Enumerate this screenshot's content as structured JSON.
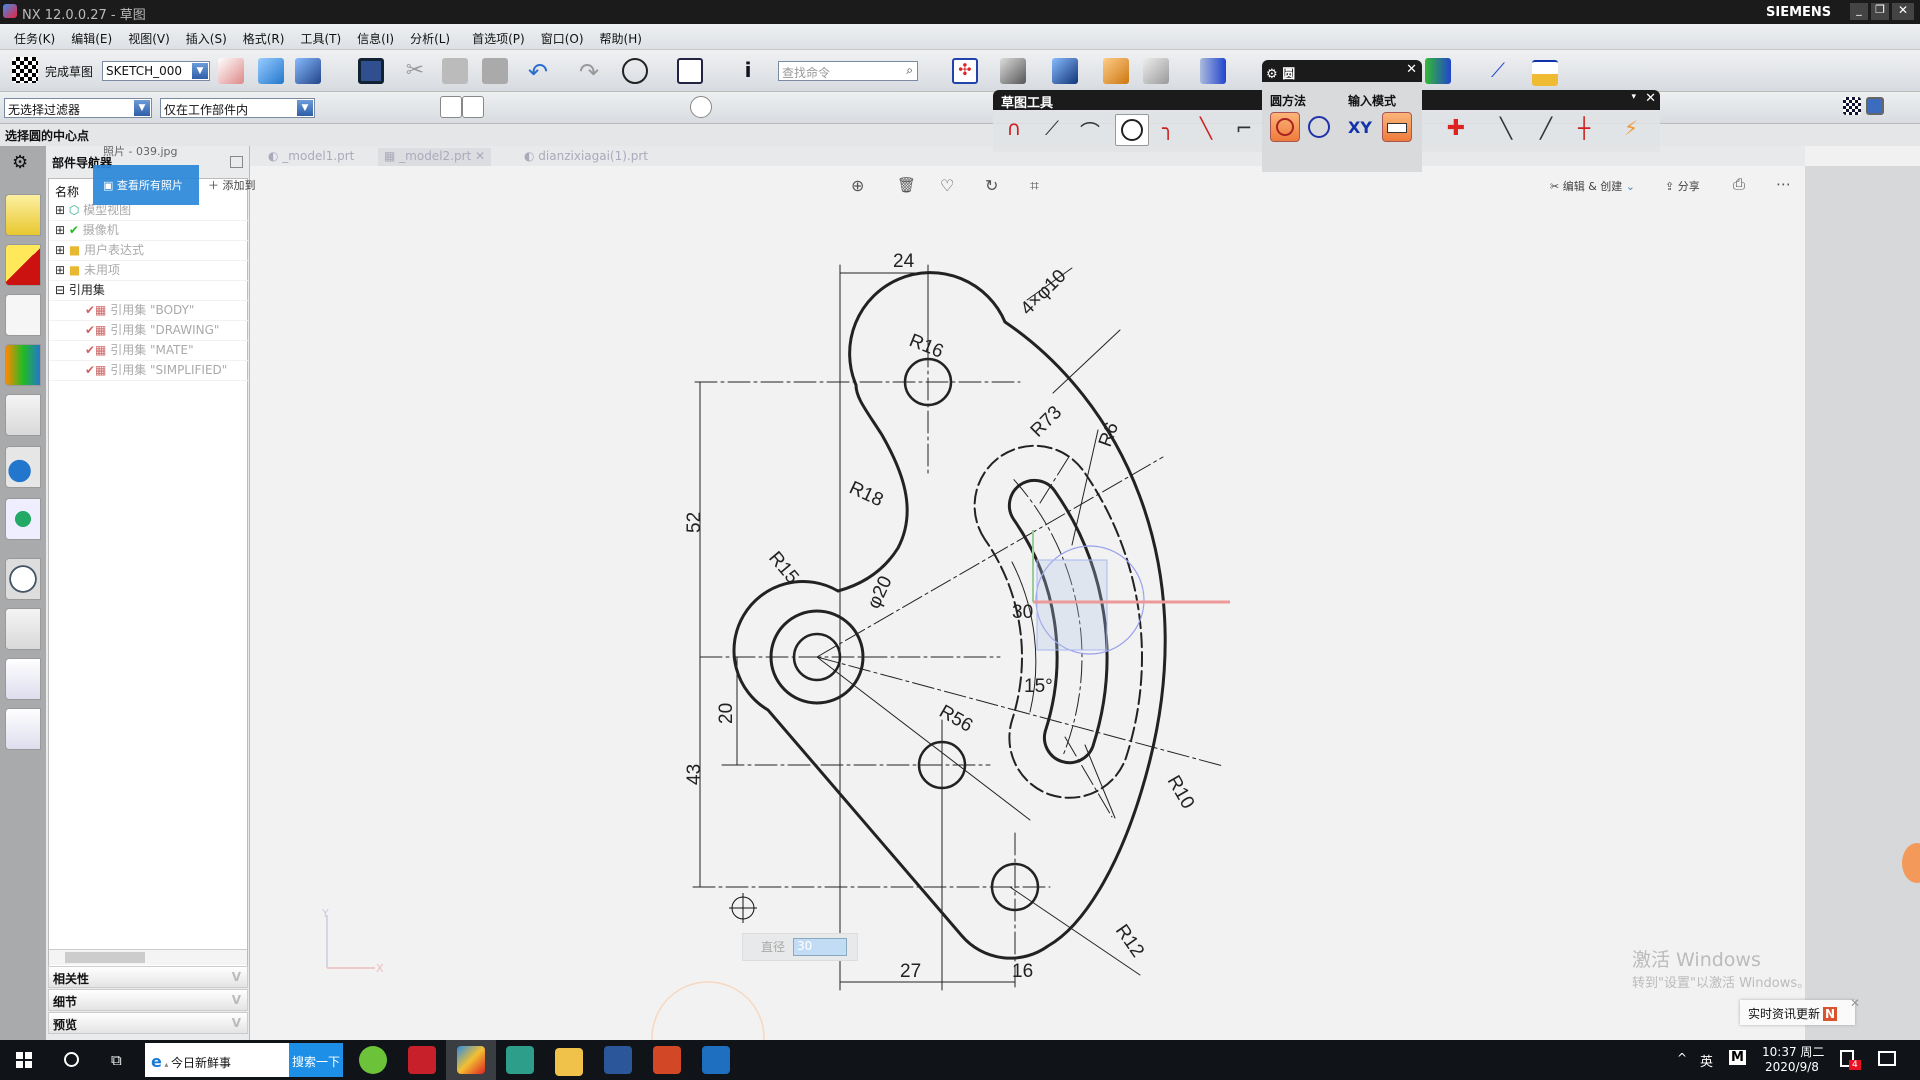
{
  "window": {
    "title": "NX 12.0.0.27 - 草图",
    "brand": "SIEMENS",
    "controls": [
      "minimize",
      "restore",
      "close"
    ]
  },
  "menu": [
    "任务(K)",
    "编辑(E)",
    "视图(V)",
    "插入(S)",
    "格式(R)",
    "工具(T)",
    "信息(I)",
    "分析(L)",
    "首选项(P)",
    "窗口(O)",
    "帮助(H)"
  ],
  "toolbar": {
    "finish_sketch": "完成草图",
    "sketch_name": "SKETCH_000",
    "search_placeholder": "查找命令",
    "filter": "无选择过滤器",
    "scope": "仅在工作部件内"
  },
  "status": "选择圆的中心点",
  "tabs": [
    "_model1.prt",
    "_model2.prt",
    "dianzixiagai(1).prt"
  ],
  "navigator": {
    "title": "部件导航器",
    "column": "名称",
    "items": [
      "模型视图",
      "摄像机",
      "用户表达式",
      "未用项",
      "引用集",
      "引用集 \"BODY\"",
      "引用集 \"DRAWING\"",
      "引用集 \"MATE\"",
      "引用集 \"SIMPLIFIED\""
    ],
    "panels": [
      "相关性",
      "细节",
      "预览"
    ]
  },
  "photo_viewer": {
    "title": "照片 - 039.jpg",
    "view_all": "查看所有照片",
    "add_to": "添加到",
    "edit_create": "编辑 & 创建",
    "share": "分享"
  },
  "sketch_tools": {
    "title": "草图工具"
  },
  "circle_dialog": {
    "title": "圆",
    "method_label": "圆方法",
    "input_mode_label": "输入模式",
    "xy": "XY"
  },
  "drawing": {
    "dims": {
      "d24": "24",
      "d52": "52",
      "d43": "43",
      "d20": "20",
      "d27": "27",
      "d16": "16",
      "a30": "30",
      "a15": "15°",
      "r16": "R16",
      "holes": "4×φ10",
      "r73": "R73",
      "r6": "R6",
      "r18": "R18",
      "r15": "R15",
      "phi20": "φ20",
      "r56": "R56",
      "r10": "R10",
      "r12": "R12"
    },
    "axis_x": "X",
    "axis_y": "Y"
  },
  "dynamic_input": {
    "label": "直径",
    "value": "30"
  },
  "watermark": {
    "line1": "激活 Windows",
    "line2": "转到\"设置\"以激活 Windows。"
  },
  "news_popup": "实时资讯更新",
  "taskbar": {
    "search_text": "今日新鲜事",
    "search_button": "搜索一下",
    "tray_lang": "英",
    "tray_ime": "M",
    "time": "10:37 周二",
    "date": "2020/9/8",
    "notify_count": "4"
  },
  "colors": {
    "accent": "#2b88d8",
    "titlebar": "#1b1b1b",
    "taskbar": "#101418",
    "highlight": "#f39a5b"
  }
}
